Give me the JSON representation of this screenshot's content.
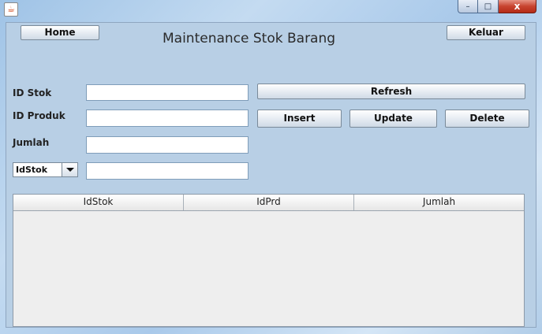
{
  "window": {
    "icon": "java-cup-icon",
    "controls": {
      "minimize": "–",
      "maximize": "□",
      "close": "x"
    }
  },
  "form": {
    "title": "Maintenance Stok Barang",
    "home_label": "Home",
    "keluar_label": "Keluar",
    "refresh_label": "Refresh",
    "insert_label": "Insert",
    "update_label": "Update",
    "delete_label": "Delete",
    "id_stok_label": "ID Stok",
    "id_produk_label": "ID Produk",
    "jumlah_label": "Jumlah",
    "id_stok_value": "",
    "id_produk_value": "",
    "jumlah_value": "",
    "search_value": "",
    "filter_selected": "IdStok"
  },
  "table": {
    "columns": [
      "IdStok",
      "IdPrd",
      "Jumlah"
    ],
    "rows": []
  },
  "colors": {
    "background": "#b8cfe5",
    "close_button": "#c7432f"
  }
}
